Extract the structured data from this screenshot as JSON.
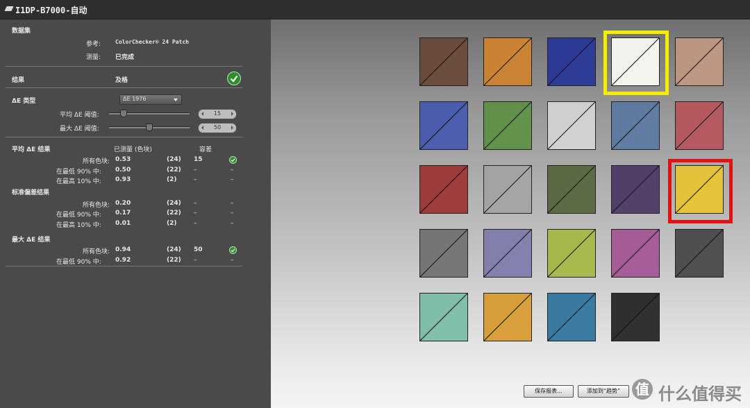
{
  "window": {
    "title": "I1DP-B7000-自动"
  },
  "dataset": {
    "heading": "数据集",
    "reference_label": "参考:",
    "reference_value": "ColorChecker® 24 Patch",
    "measured_label": "测量:",
    "measured_value": "已完成"
  },
  "result": {
    "heading": "结果",
    "value": "及格"
  },
  "delta_e": {
    "type_label": "ΔE 类型",
    "type_value": "ΔE 1976",
    "avg_threshold_label": "平均 ΔE 阈值:",
    "avg_threshold_value": "15",
    "max_threshold_label": "最大 ΔE 阈值:",
    "max_threshold_value": "50"
  },
  "avg_results": {
    "heading": "平均 ΔE 结果",
    "col_measured": "已测量 (色块)",
    "col_tolerance": "容差",
    "rows": [
      {
        "label": "所有色块:",
        "value": "0.53",
        "count": "(24)",
        "tolerance": "15",
        "pass": true
      },
      {
        "label": "在最低 90% 中:",
        "value": "0.50",
        "count": "(22)",
        "tolerance": "–",
        "dash": "–"
      },
      {
        "label": "在最高 10% 中:",
        "value": "0.93",
        "count": "(2)",
        "tolerance": "–",
        "dash": "–"
      }
    ]
  },
  "std_results": {
    "heading": "标准偏差结果",
    "rows": [
      {
        "label": "所有色块:",
        "value": "0.20",
        "count": "(24)",
        "tolerance": "–",
        "dash": "–"
      },
      {
        "label": "在最低 90% 中:",
        "value": "0.17",
        "count": "(22)",
        "tolerance": "–",
        "dash": "–"
      },
      {
        "label": "在最高 10% 中:",
        "value": "0.01",
        "count": "(2)",
        "tolerance": "–",
        "dash": "–"
      }
    ]
  },
  "max_results": {
    "heading": "最大 ΔE 结果",
    "rows": [
      {
        "label": "所有色块:",
        "value": "0.94",
        "count": "(24)",
        "tolerance": "50",
        "pass": true
      },
      {
        "label": "在最低 90% 中:",
        "value": "0.92",
        "count": "(22)",
        "tolerance": "–",
        "dash": "–"
      }
    ]
  },
  "patches": [
    {
      "ref": "#6a4c3c",
      "meas": "#6c4d3e"
    },
    {
      "ref": "#c98133",
      "meas": "#ca8235"
    },
    {
      "ref": "#2c3a96",
      "meas": "#2e3c98"
    },
    {
      "ref": "#f2f1ec",
      "meas": "#f4f3ee"
    },
    {
      "ref": "#bb9580",
      "meas": "#bd9782"
    },
    {
      "ref": "#4a5cab",
      "meas": "#4c5ead"
    },
    {
      "ref": "#60904a",
      "meas": "#62924c"
    },
    {
      "ref": "#cfcfcf",
      "meas": "#d1d1d1"
    },
    {
      "ref": "#5e7aa0",
      "meas": "#607ca2"
    },
    {
      "ref": "#b3585e",
      "meas": "#b55a60"
    },
    {
      "ref": "#9c3b3a",
      "meas": "#9e3d3c"
    },
    {
      "ref": "#a3a3a3",
      "meas": "#a5a5a5"
    },
    {
      "ref": "#5a6844",
      "meas": "#5c6a46"
    },
    {
      "ref": "#513f6a",
      "meas": "#53416c"
    },
    {
      "ref": "#e3c23a",
      "meas": "#e5c43c"
    },
    {
      "ref": "#757575",
      "meas": "#777777"
    },
    {
      "ref": "#8180ad",
      "meas": "#8382af"
    },
    {
      "ref": "#a6b84b",
      "meas": "#a8ba4d"
    },
    {
      "ref": "#a45b96",
      "meas": "#a65d98"
    },
    {
      "ref": "#4f4f4f",
      "meas": "#515151"
    },
    {
      "ref": "#7fbcaa",
      "meas": "#81beac"
    },
    {
      "ref": "#d69d3a",
      "meas": "#d89f3c"
    },
    {
      "ref": "#3a7aa0",
      "meas": "#3c7ca2"
    },
    {
      "ref": "#2f2f2f",
      "meas": "#313131"
    }
  ],
  "buttons": {
    "save_report": "保存报表...",
    "add_to_trend": "添加到“趋势”"
  },
  "watermark": {
    "glyph": "值",
    "text": "什么值得买"
  }
}
